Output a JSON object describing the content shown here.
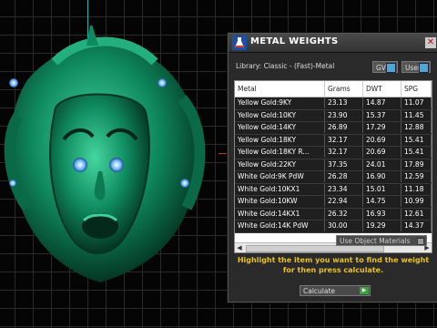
{
  "window": {
    "title": "METAL WEIGHTS",
    "close_icon": "close-icon"
  },
  "library": {
    "label": "Library: Classic - (Fast)-Metal",
    "gv_label": "GV",
    "user_label": "User"
  },
  "table": {
    "columns": [
      "Metal",
      "Grams",
      "DWT",
      "SPG"
    ],
    "rows": [
      [
        "Yellow Gold:9KY",
        "23.13",
        "14.87",
        "11.07"
      ],
      [
        "Yellow Gold:10KY",
        "23.90",
        "15.37",
        "11.45"
      ],
      [
        "Yellow Gold:14KY",
        "26.89",
        "17.29",
        "12.88"
      ],
      [
        "Yellow Gold:18KY",
        "32.17",
        "20.69",
        "15.41"
      ],
      [
        "Yellow Gold:18KY R...",
        "32.17",
        "20.69",
        "15.41"
      ],
      [
        "Yellow Gold:22KY",
        "37.35",
        "24.01",
        "17.89"
      ],
      [
        "White Gold:9K PdW",
        "26.28",
        "16.90",
        "12.59"
      ],
      [
        "White Gold:10KX1",
        "23.34",
        "15.01",
        "11.18"
      ],
      [
        "White Gold:10KW",
        "22.94",
        "14.75",
        "10.99"
      ],
      [
        "White Gold:14KX1",
        "26.32",
        "16.93",
        "12.61"
      ],
      [
        "White Gold:14K PdW",
        "30.00",
        "19.29",
        "14.37"
      ]
    ]
  },
  "options": {
    "use_object_materials": "Use Object Materials"
  },
  "hint": "Highlight the item you want to find the weight for then press calculate.",
  "calculate_label": "Calculate",
  "colors": {
    "accent_hint": "#e8c020",
    "model_green": "#0f8a5f",
    "eye_glow": "#6fb8ff"
  }
}
